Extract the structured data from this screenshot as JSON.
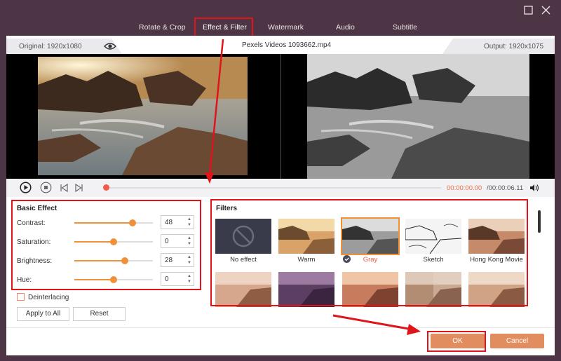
{
  "window": {
    "maximize_icon": "square-icon",
    "close_icon": "close-icon"
  },
  "tabs": [
    {
      "label": "Rotate & Crop"
    },
    {
      "label": "Effect & Filter",
      "active": true
    },
    {
      "label": "Watermark"
    },
    {
      "label": "Audio"
    },
    {
      "label": "Subtitle"
    }
  ],
  "info": {
    "original": "Original: 1920x1080",
    "filename": "Pexels Videos 1093662.mp4",
    "output": "Output: 1920x1075"
  },
  "player": {
    "time_current": "00:00:00.00",
    "time_total": "/00:00:06.11",
    "progress": 0
  },
  "basic_effect": {
    "title": "Basic Effect",
    "sliders": [
      {
        "label": "Contrast:",
        "value": "48",
        "level": 0.74
      },
      {
        "label": "Saturation:",
        "value": "0",
        "level": 0.5
      },
      {
        "label": "Brightness:",
        "value": "28",
        "level": 0.64
      },
      {
        "label": "Hue:",
        "value": "0",
        "level": 0.5
      }
    ],
    "deinterlacing": "Deinterlacing",
    "apply_all": "Apply to All",
    "reset": "Reset"
  },
  "filters": {
    "title": "Filters",
    "row1": [
      "No effect",
      "Warm",
      "Gray",
      "Sketch",
      "Hong Kong Movie"
    ],
    "selected": "Gray"
  },
  "footer": {
    "ok": "OK",
    "cancel": "Cancel"
  },
  "colors": {
    "accent": "#f0913a",
    "highlight": "#e0141b",
    "button": "#e28d5f",
    "titlebar": "#4d3546"
  }
}
